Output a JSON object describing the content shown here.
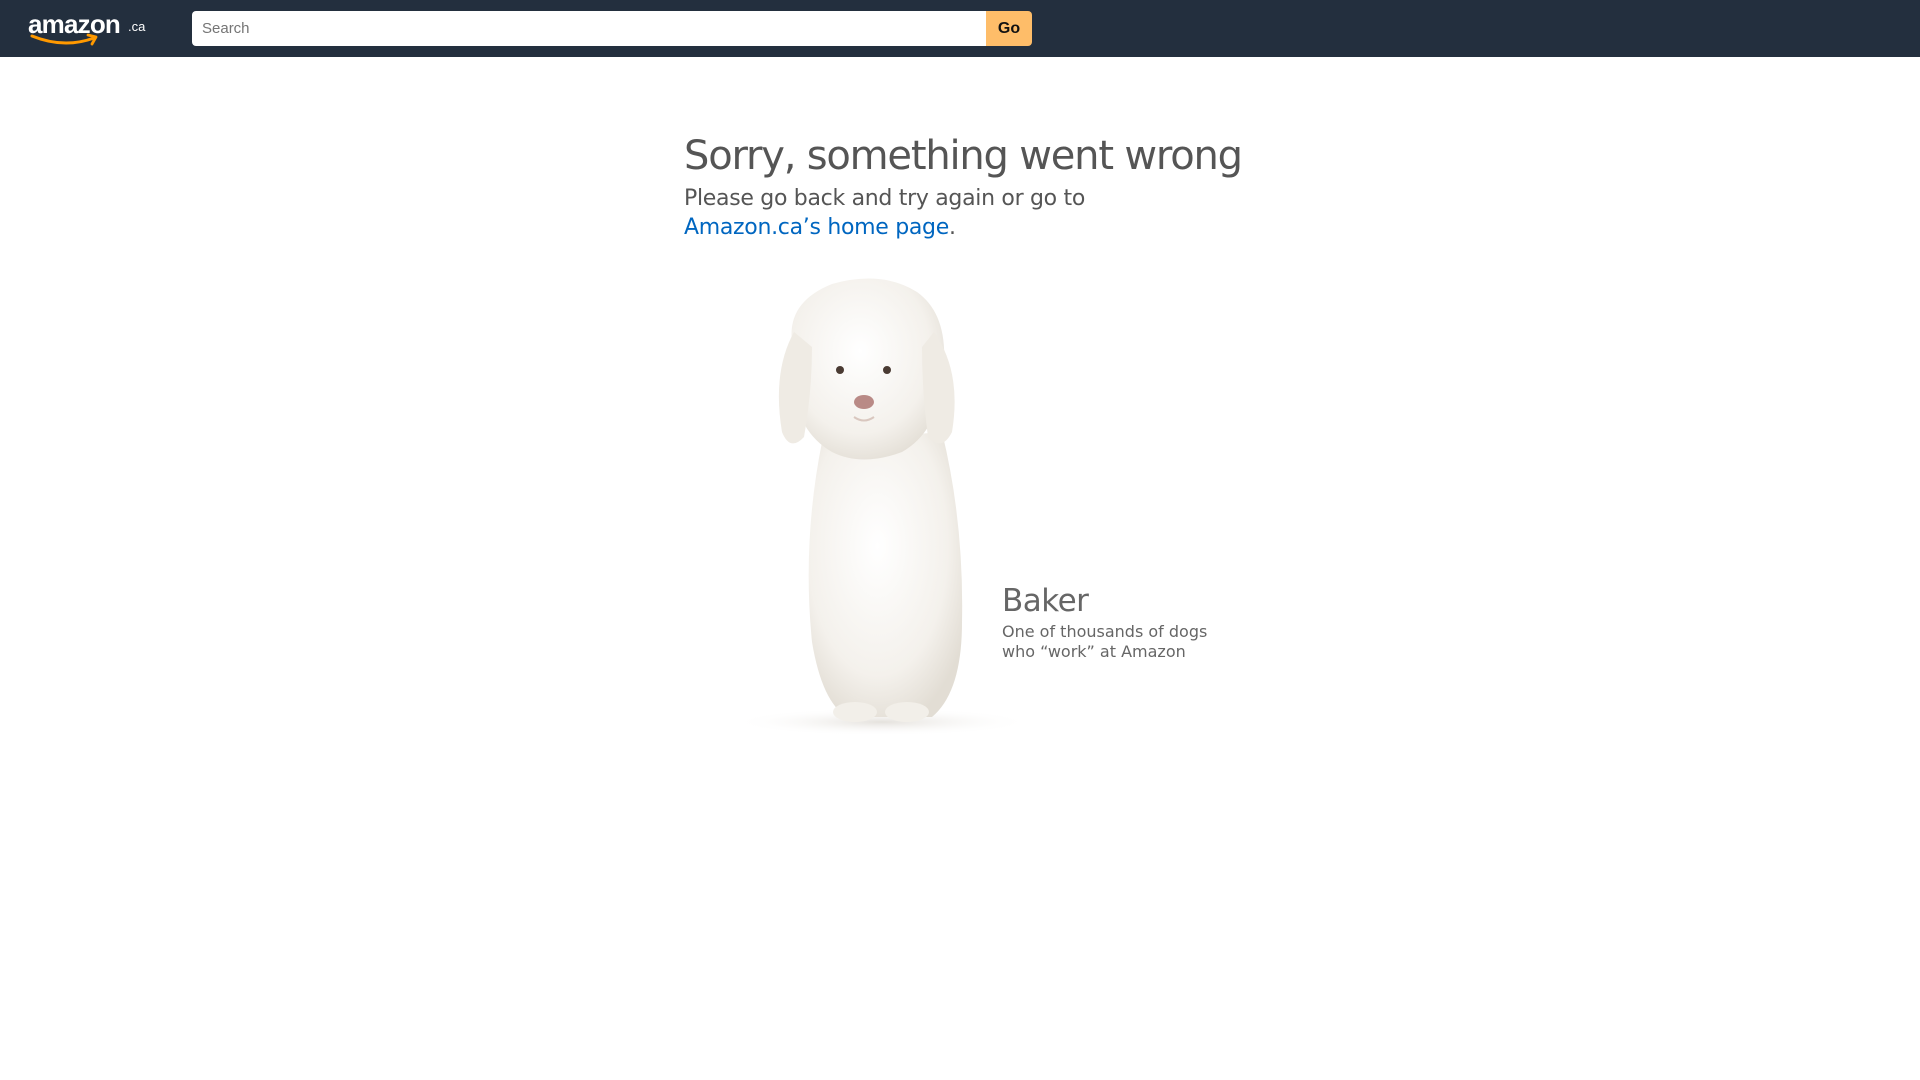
{
  "header": {
    "logo_text": "amazon",
    "logo_tld": ".ca",
    "search_placeholder": "Search",
    "search_value": "",
    "go_label": "Go",
    "colors": {
      "navbar": "#232f3e",
      "go_button": "#febd69",
      "logo_smile": "#f90"
    }
  },
  "error": {
    "title": "Sorry, something went wrong",
    "message": "Please go back and try again or go to",
    "link_text": "Amazon.ca’s home page",
    "trailing": ".",
    "link_color": "#0066c0"
  },
  "dog": {
    "image_icon": "dog-photo",
    "name": "Baker",
    "description": "One of thousands of dogs who “work” at Amazon"
  }
}
